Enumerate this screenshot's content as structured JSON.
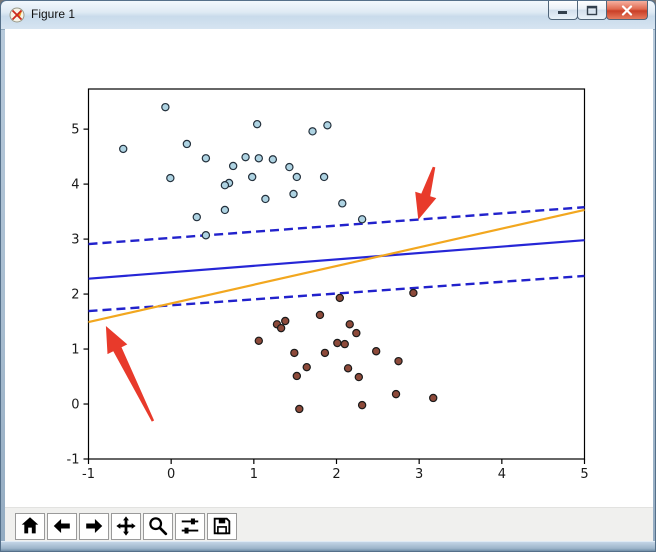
{
  "window": {
    "title": "Figure 1",
    "icon": "matplotlib-logo-icon",
    "controls": [
      {
        "name": "minimize"
      },
      {
        "name": "maximize"
      },
      {
        "name": "close"
      }
    ]
  },
  "toolbar": {
    "buttons": [
      {
        "name": "home"
      },
      {
        "name": "back"
      },
      {
        "name": "forward"
      },
      {
        "name": "pan"
      },
      {
        "name": "zoom"
      },
      {
        "name": "configure-subplots"
      },
      {
        "name": "save"
      }
    ]
  },
  "chart_data": {
    "type": "scatter",
    "title": "",
    "xlabel": "",
    "ylabel": "",
    "xlim": [
      -1,
      5
    ],
    "ylim": [
      -1,
      5.73
    ],
    "x_ticks": [
      -1,
      0,
      1,
      2,
      3,
      4,
      5
    ],
    "y_ticks": [
      -1,
      0,
      1,
      2,
      3,
      4,
      5
    ],
    "grid": false,
    "legend": null,
    "series": [
      {
        "name": "cluster-upper",
        "marker": "circle",
        "fill": "#aed3e2",
        "edge": "#23303c",
        "points": [
          [
            -0.07,
            5.4
          ],
          [
            1.04,
            5.09
          ],
          [
            1.71,
            4.96
          ],
          [
            1.89,
            5.07
          ],
          [
            0.19,
            4.73
          ],
          [
            -0.58,
            4.64
          ],
          [
            0.42,
            4.47
          ],
          [
            0.9,
            4.49
          ],
          [
            1.06,
            4.47
          ],
          [
            1.23,
            4.45
          ],
          [
            0.75,
            4.33
          ],
          [
            1.43,
            4.31
          ],
          [
            1.52,
            4.13
          ],
          [
            -0.01,
            4.11
          ],
          [
            1.85,
            4.13
          ],
          [
            0.98,
            4.13
          ],
          [
            0.7,
            4.02
          ],
          [
            0.65,
            3.98
          ],
          [
            1.48,
            3.82
          ],
          [
            1.14,
            3.73
          ],
          [
            2.07,
            3.65
          ],
          [
            0.65,
            3.53
          ],
          [
            0.31,
            3.4
          ],
          [
            2.31,
            3.36
          ],
          [
            0.42,
            3.07
          ]
        ]
      },
      {
        "name": "cluster-lower",
        "marker": "circle",
        "fill": "#8d4a3a",
        "edge": "#1a1a1a",
        "points": [
          [
            2.04,
            1.93
          ],
          [
            2.93,
            2.02
          ],
          [
            1.8,
            1.62
          ],
          [
            1.38,
            1.51
          ],
          [
            1.28,
            1.45
          ],
          [
            1.33,
            1.38
          ],
          [
            1.06,
            1.15
          ],
          [
            2.16,
            1.45
          ],
          [
            2.24,
            1.29
          ],
          [
            2.01,
            1.11
          ],
          [
            2.1,
            1.09
          ],
          [
            1.49,
            0.93
          ],
          [
            1.86,
            0.93
          ],
          [
            2.48,
            0.96
          ],
          [
            2.75,
            0.78
          ],
          [
            1.64,
            0.67
          ],
          [
            2.14,
            0.65
          ],
          [
            1.52,
            0.51
          ],
          [
            2.27,
            0.49
          ],
          [
            2.72,
            0.18
          ],
          [
            3.17,
            0.11
          ],
          [
            2.31,
            -0.02
          ],
          [
            1.55,
            -0.09
          ]
        ]
      }
    ],
    "lines": [
      {
        "name": "decision-boundary",
        "color": "#2626d6",
        "dash": "solid",
        "points": [
          [
            -1,
            2.28
          ],
          [
            5,
            2.98
          ]
        ]
      },
      {
        "name": "upper-margin",
        "color": "#2222cc",
        "dash": "dashed",
        "points": [
          [
            -1,
            2.91
          ],
          [
            5,
            3.58
          ]
        ]
      },
      {
        "name": "lower-margin",
        "color": "#2222cc",
        "dash": "dashed",
        "points": [
          [
            -1,
            1.69
          ],
          [
            5,
            2.33
          ]
        ]
      },
      {
        "name": "orange-line",
        "color": "#f2a71f",
        "dash": "solid",
        "points": [
          [
            -1,
            1.49
          ],
          [
            5,
            3.53
          ]
        ]
      }
    ],
    "annotations": [
      {
        "name": "arrow-lower-left",
        "color": "#e83a2b",
        "tail": [
          -0.22,
          -0.31
        ],
        "tip": [
          -0.79,
          1.42
        ]
      },
      {
        "name": "arrow-upper-right",
        "color": "#e83a2b",
        "tail": [
          3.18,
          4.31
        ],
        "tip": [
          2.99,
          3.35
        ]
      }
    ],
    "colors": {
      "axes_spine": "#000000",
      "figure_background": "#ffffff",
      "plot_background": "#ffffff"
    }
  }
}
